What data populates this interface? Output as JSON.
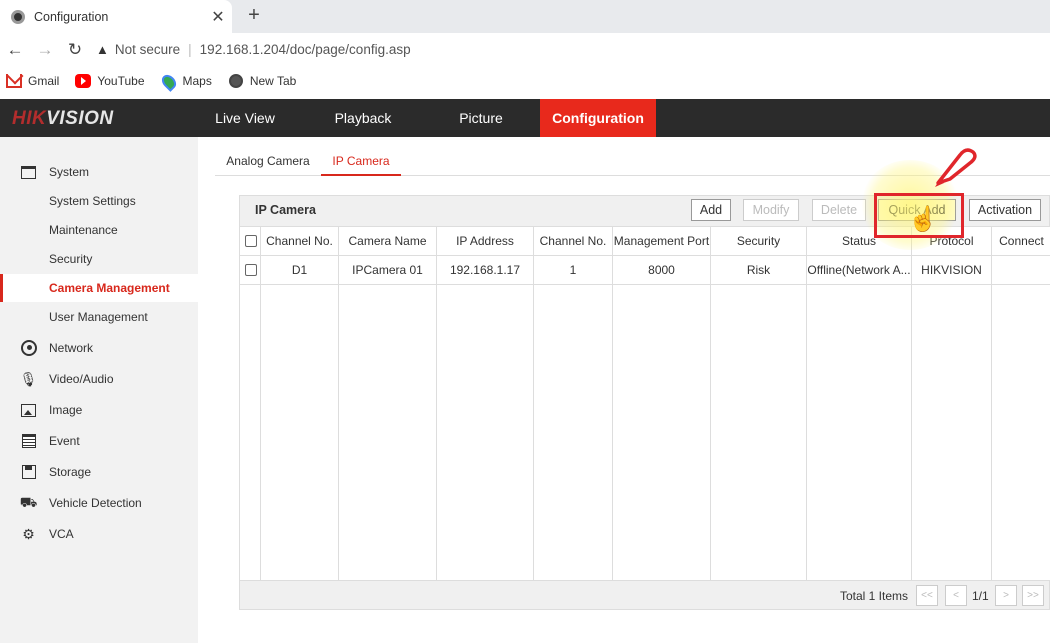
{
  "browser": {
    "tab_title": "Configuration",
    "tab_close": "✕",
    "new_tab": "+",
    "not_secure": "Not secure",
    "url": "192.168.1.204/doc/page/config.asp",
    "bookmarks": [
      {
        "label": "Gmail",
        "icon": "gmail-icon"
      },
      {
        "label": "YouTube",
        "icon": "youtube-icon"
      },
      {
        "label": "Maps",
        "icon": "maps-icon"
      },
      {
        "label": "New Tab",
        "icon": "globe-icon"
      }
    ]
  },
  "header": {
    "logo_red": "HIK",
    "logo_white": "VISION",
    "nav": [
      "Live View",
      "Playback",
      "Picture",
      "Configuration"
    ],
    "active": "Configuration",
    "accent": "#e8291c"
  },
  "sidebar": {
    "items": [
      {
        "label": "System",
        "icon": "system-icon"
      },
      {
        "label": "System Settings"
      },
      {
        "label": "Maintenance"
      },
      {
        "label": "Security"
      },
      {
        "label": "Camera Management"
      },
      {
        "label": "User Management"
      },
      {
        "label": "Network",
        "icon": "network-icon"
      },
      {
        "label": "Video/Audio",
        "icon": "microphone-icon"
      },
      {
        "label": "Image",
        "icon": "image-icon"
      },
      {
        "label": "Event",
        "icon": "event-icon"
      },
      {
        "label": "Storage",
        "icon": "storage-icon"
      },
      {
        "label": "Vehicle Detection",
        "icon": "vehicle-detection-icon"
      },
      {
        "label": "VCA",
        "icon": "vca-icon"
      }
    ],
    "active": "Camera Management"
  },
  "main": {
    "tabs": [
      "Analog Camera",
      "IP Camera"
    ],
    "active_tab": "IP Camera",
    "panel_title": "IP Camera",
    "buttons": {
      "add": "Add",
      "modify": "Modify",
      "delete": "Delete",
      "quick_add": "Quick Add",
      "activation": "Activation"
    },
    "columns": [
      "Channel No.",
      "Camera Name",
      "IP Address",
      "Channel No.",
      "Management Port",
      "Security",
      "Status",
      "Protocol",
      "Connect"
    ],
    "rows": [
      [
        "D1",
        "IPCamera 01",
        "192.168.1.17",
        "1",
        "8000",
        "Risk",
        "Offline(Network A...",
        "HIKVISION",
        ""
      ]
    ],
    "footer": {
      "total": "Total 1 Items",
      "first": "<<",
      "prev": "<",
      "page": "1/1",
      "next": ">",
      "last": ">>"
    }
  }
}
